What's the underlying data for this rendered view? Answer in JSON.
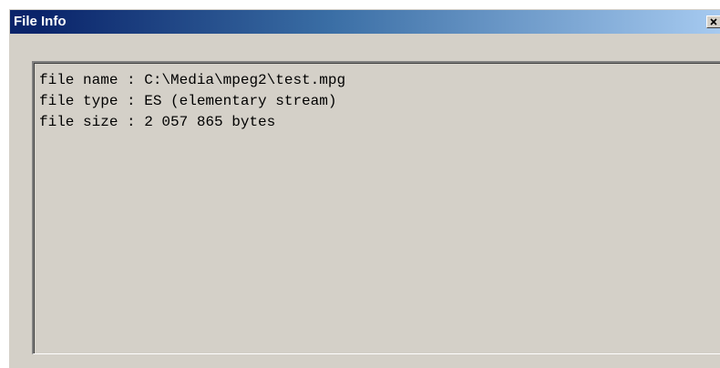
{
  "window": {
    "title": "File Info",
    "close_icon": "close-icon"
  },
  "info": {
    "lines": [
      "file name : C:\\Media\\mpeg2\\test.mpg",
      "file type : ES (elementary stream)",
      "file size : 2 057 865 bytes"
    ]
  },
  "colors": {
    "title_bar_start": "#0a246a",
    "title_bar_end": "#a6caf0",
    "window_face": "#d4d0c8",
    "title_text": "#ffffff"
  }
}
